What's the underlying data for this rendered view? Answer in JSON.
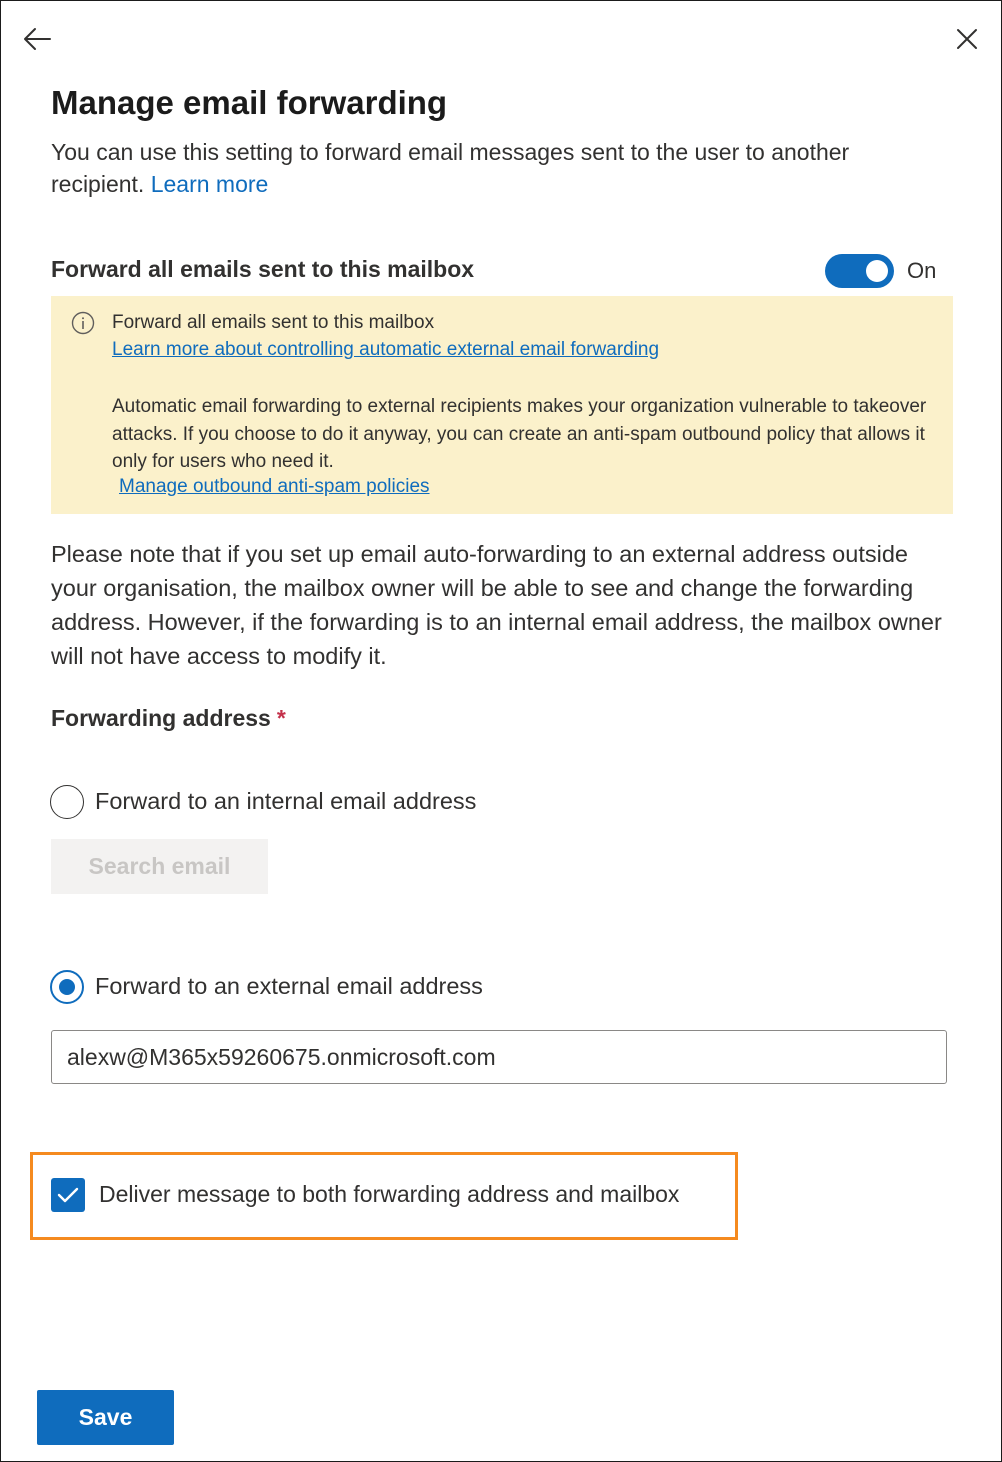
{
  "header": {
    "back_icon": "arrow-left-icon",
    "close_icon": "close-icon"
  },
  "panel": {
    "title": "Manage email forwarding",
    "description": "You can use this setting to forward email messages sent to the user to another recipient.",
    "learn_more": "Learn more"
  },
  "forward_toggle": {
    "label": "Forward all emails sent to this mailbox",
    "state": "On",
    "on": true
  },
  "banner": {
    "icon": "info-icon",
    "title": "Forward all emails sent to this mailbox",
    "link": "Learn more about controlling automatic external email forwarding",
    "body": "Automatic email forwarding to external recipients makes your organization vulnerable to takeover attacks. If you choose to do it anyway, you can create an anti-spam outbound policy that allows it only for users who need it.",
    "policy_link": "Manage outbound anti-spam policies",
    "background": "#fbf1cb"
  },
  "note": "Please note that if you set up email auto-forwarding to an external address outside your organisation, the mailbox owner will be able to see and change the forwarding address. However, if the forwarding is to an internal email address, the mailbox owner will not have access to modify it.",
  "forwarding": {
    "label": "Forwarding address",
    "required_mark": "*",
    "internal": {
      "label": "Forward to an internal email address",
      "selected": false,
      "search_placeholder": "Search email"
    },
    "external": {
      "label": "Forward to an external email address",
      "selected": true,
      "value": "alexw@M365x59260675.onmicrosoft.com"
    }
  },
  "deliver_both": {
    "label": "Deliver message to both forwarding address and mailbox",
    "checked": true,
    "highlight_color": "#f58a1f"
  },
  "footer": {
    "save_label": "Save"
  },
  "colors": {
    "accent": "#0f6cbd",
    "text": "#323130"
  }
}
